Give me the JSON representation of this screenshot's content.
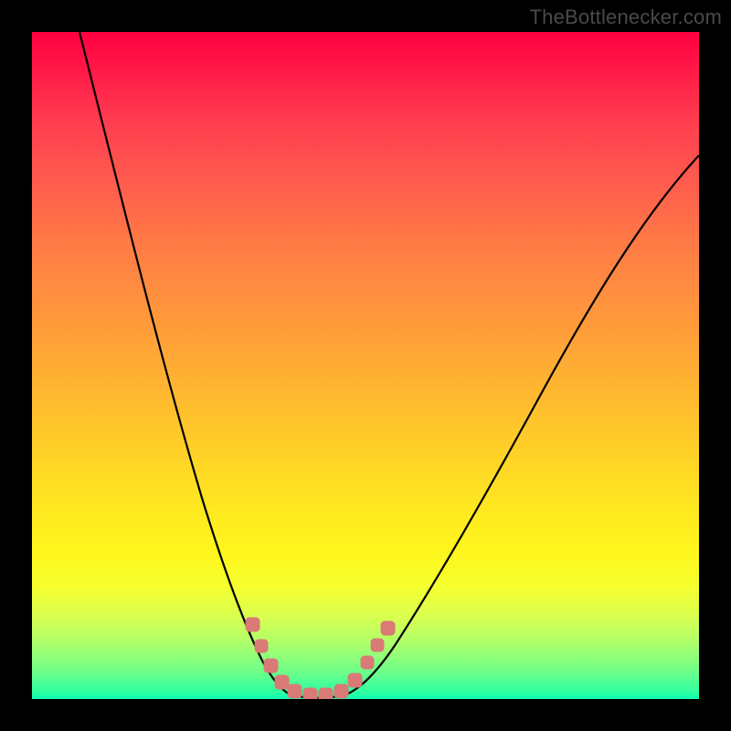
{
  "attribution": "TheBottlenecker.com",
  "colors": {
    "frame": "#000000",
    "curve": "#000000",
    "markers": "#d97a76",
    "gradient_top": "#ff0040",
    "gradient_bottom": "#0fffb5"
  },
  "chart_data": {
    "type": "line",
    "title": "",
    "xlabel": "",
    "ylabel": "",
    "xlim": [
      0,
      100
    ],
    "ylim": [
      0,
      100
    ],
    "series": [
      {
        "name": "bottleneck-curve",
        "x": [
          7,
          12,
          18,
          24,
          30,
          34,
          37,
          39,
          41,
          43,
          45,
          47,
          50,
          54,
          60,
          68,
          76,
          84,
          92,
          100
        ],
        "y": [
          100,
          80,
          60,
          42,
          27,
          17,
          10,
          5,
          1,
          0,
          0,
          1,
          4,
          9,
          18,
          30,
          45,
          58,
          72,
          82
        ]
      }
    ],
    "markers": {
      "name": "highlight-points",
      "style": "rounded-square",
      "color": "#d97a76",
      "x": [
        32,
        33.5,
        35,
        36.5,
        38.5,
        41,
        43,
        45.5,
        47.5,
        49.5,
        51,
        52.5
      ],
      "y": [
        12,
        9,
        6,
        4,
        2,
        1,
        1,
        2,
        4,
        6,
        9,
        12
      ]
    },
    "background": {
      "type": "vertical-gradient",
      "stops": [
        {
          "pos": 0,
          "color": "#ff0040"
        },
        {
          "pos": 20,
          "color": "#ff5a4e"
        },
        {
          "pos": 45,
          "color": "#ffa637"
        },
        {
          "pos": 70,
          "color": "#ffe521"
        },
        {
          "pos": 88,
          "color": "#d6ff52"
        },
        {
          "pos": 100,
          "color": "#0fffb5"
        }
      ]
    }
  }
}
